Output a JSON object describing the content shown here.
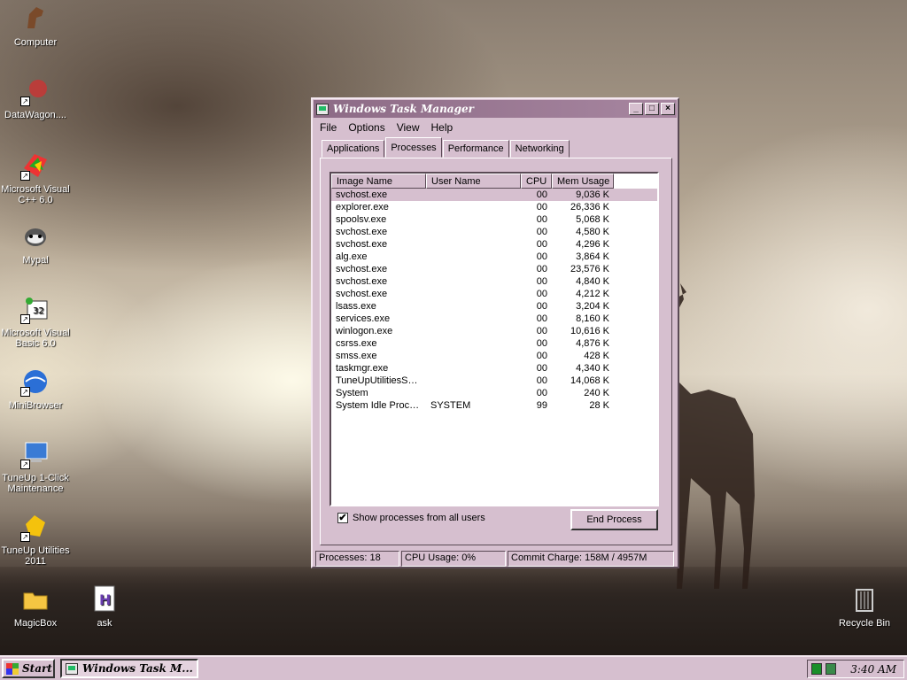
{
  "desktop": {
    "icons": [
      {
        "label": "Computer",
        "icon": "horse-computer-icon"
      },
      {
        "label": "DataWagon....",
        "icon": "datawagon-icon"
      },
      {
        "label": "Microsoft Visual C++ 6.0",
        "icon": "visual-cpp-icon"
      },
      {
        "label": "Mypal",
        "icon": "mypal-icon"
      },
      {
        "label": "Microsoft Visual Basic 6.0",
        "icon": "visual-basic-icon"
      },
      {
        "label": "MiniBrowser",
        "icon": "minibrowser-icon"
      },
      {
        "label": "TuneUp 1-Click Maintenance",
        "icon": "tuneup-maintenance-icon"
      },
      {
        "label": "TuneUp Utilities 2011",
        "icon": "tuneup-utilities-icon"
      },
      {
        "label": "MagicBox",
        "icon": "folder-icon"
      },
      {
        "label": "ask",
        "icon": "html-file-icon"
      },
      {
        "label": "Recycle Bin",
        "icon": "recycle-bin-icon"
      }
    ]
  },
  "window": {
    "title": "Windows Task Manager",
    "menu": [
      "File",
      "Options",
      "View",
      "Help"
    ],
    "tabs": [
      "Applications",
      "Processes",
      "Performance",
      "Networking"
    ],
    "active_tab": "Processes",
    "columns": [
      "Image Name",
      "User Name",
      "CPU",
      "Mem Usage"
    ],
    "processes": [
      {
        "name": "svchost.exe",
        "user": "",
        "cpu": "00",
        "mem": "9,036 K"
      },
      {
        "name": "explorer.exe",
        "user": "",
        "cpu": "00",
        "mem": "26,336 K"
      },
      {
        "name": "spoolsv.exe",
        "user": "",
        "cpu": "00",
        "mem": "5,068 K"
      },
      {
        "name": "svchost.exe",
        "user": "",
        "cpu": "00",
        "mem": "4,580 K"
      },
      {
        "name": "svchost.exe",
        "user": "",
        "cpu": "00",
        "mem": "4,296 K"
      },
      {
        "name": "alg.exe",
        "user": "",
        "cpu": "00",
        "mem": "3,864 K"
      },
      {
        "name": "svchost.exe",
        "user": "",
        "cpu": "00",
        "mem": "23,576 K"
      },
      {
        "name": "svchost.exe",
        "user": "",
        "cpu": "00",
        "mem": "4,840 K"
      },
      {
        "name": "svchost.exe",
        "user": "",
        "cpu": "00",
        "mem": "4,212 K"
      },
      {
        "name": "lsass.exe",
        "user": "",
        "cpu": "00",
        "mem": "3,204 K"
      },
      {
        "name": "services.exe",
        "user": "",
        "cpu": "00",
        "mem": "8,160 K"
      },
      {
        "name": "winlogon.exe",
        "user": "",
        "cpu": "00",
        "mem": "10,616 K"
      },
      {
        "name": "csrss.exe",
        "user": "",
        "cpu": "00",
        "mem": "4,876 K"
      },
      {
        "name": "smss.exe",
        "user": "",
        "cpu": "00",
        "mem": "428 K"
      },
      {
        "name": "taskmgr.exe",
        "user": "",
        "cpu": "00",
        "mem": "4,340 K"
      },
      {
        "name": "TuneUpUtilitiesSer...",
        "user": "",
        "cpu": "00",
        "mem": "14,068 K"
      },
      {
        "name": "System",
        "user": "",
        "cpu": "00",
        "mem": "240 K"
      },
      {
        "name": "System Idle Process",
        "user": "SYSTEM",
        "cpu": "99",
        "mem": "28 K"
      }
    ],
    "show_all_label": "Show processes from all users",
    "show_all_checked": "✔",
    "end_process_label": "End Process",
    "status": {
      "processes": "Processes: 18",
      "cpu": "CPU Usage: 0%",
      "commit": "Commit Charge: 158M / 4957M"
    }
  },
  "taskbar": {
    "start_label": "Start",
    "task_label": "Windows Task M...",
    "clock": "3:40 AM"
  }
}
